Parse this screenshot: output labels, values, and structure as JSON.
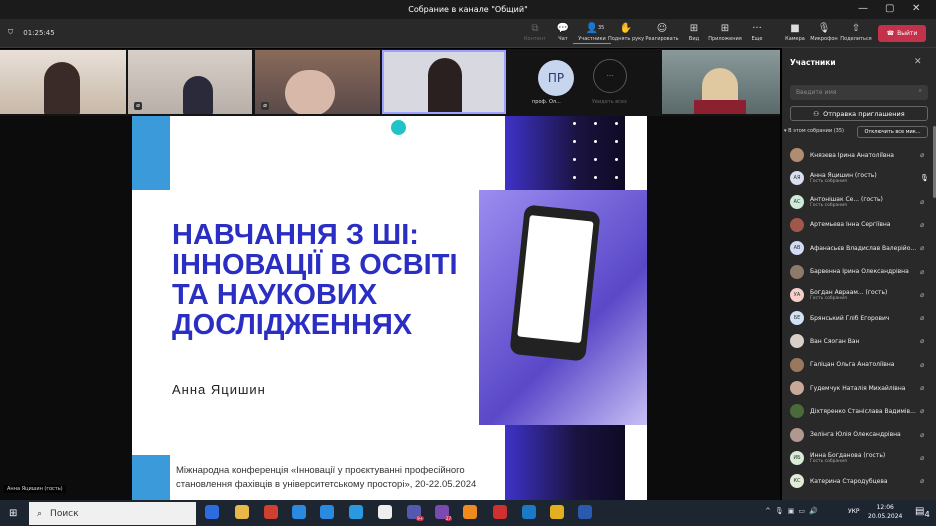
{
  "window": {
    "title": "Собрание в канале \"Общий\"",
    "minimize": "—",
    "maximize": "▢",
    "close": "✕"
  },
  "toolbar": {
    "timer": "01:25:45",
    "items": [
      {
        "label": "Контент",
        "icon": "share-icon",
        "glyph": "⧉"
      },
      {
        "label": "Чат",
        "icon": "chat-icon",
        "glyph": "💬"
      },
      {
        "label": "Участники",
        "icon": "people-icon",
        "glyph": "👤",
        "count": "35"
      },
      {
        "label": "Поднять руку",
        "icon": "hand-icon",
        "glyph": "✋"
      },
      {
        "label": "Реагировать",
        "icon": "emoji-icon",
        "glyph": "☺"
      },
      {
        "label": "Вид",
        "icon": "grid-icon",
        "glyph": "⊞"
      },
      {
        "label": "Приложения",
        "icon": "plus-icon",
        "glyph": "⊞"
      },
      {
        "label": "Еще",
        "icon": "more-icon",
        "glyph": "···"
      },
      {
        "label": "Камера",
        "icon": "camera-icon",
        "glyph": "■"
      },
      {
        "label": "Микрофон",
        "icon": "mic-off-icon",
        "glyph": "🎙"
      },
      {
        "label": "Поделиться",
        "icon": "share-screen-icon",
        "glyph": "⇧"
      }
    ],
    "leave": "Выйти"
  },
  "strip": {
    "avatar_initials": "ПР",
    "avatar_name": "проф. Ол...",
    "more_label": "Увидеть всех",
    "more_glyph": "···"
  },
  "slide": {
    "title": "НАВЧАННЯ З ШІ: ІННОВАЦІЇ В ОСВІТІ ТА НАУКОВИХ ДОСЛІДЖЕННЯХ",
    "author": "Анна Яцишин",
    "footer": "Міжнародна конференція «Інновації у проєктуванні професійного становлення фахівців в університетському просторі», 20-22.05.2024"
  },
  "speaker_label": "Анна Яцишин (гость)",
  "panel": {
    "title": "Участники",
    "search_placeholder": "Введите имя",
    "invite": "Отправка приглашения",
    "section": "В этом собрании (35)",
    "mute_all": "Отключить все мик...",
    "participants": [
      {
        "name": "Князева Ірина Анатоліївна",
        "initials": "",
        "color": "#b08c70"
      },
      {
        "name": "Анна Яцишин (гость)",
        "sub": "Гость собрания",
        "initials": "АЯ",
        "color": "#d9dff0",
        "mic": "on"
      },
      {
        "name": "Антонішак Се...  (гость)",
        "sub": "Гость собрания",
        "initials": "АС",
        "color": "#cdebd8"
      },
      {
        "name": "Артемьева Інна Сергіївна",
        "initials": "",
        "color": "#a0584a"
      },
      {
        "name": "Афанасьєв Владислав Валерійо...",
        "initials": "АВ",
        "color": "#d2dcf5"
      },
      {
        "name": "Барвенна Ірина Олександрівна",
        "initials": "",
        "color": "#8c7a6a"
      },
      {
        "name": "Богдан Авраам... (гость)",
        "sub": "Гость собрания",
        "initials": "УА",
        "color": "#f5d0c8"
      },
      {
        "name": "Брянський Гліб Егорович",
        "initials": "БЕ",
        "color": "#d2e2f5"
      },
      {
        "name": "Ван Сяоган Ван",
        "initials": "",
        "color": "#d8d0c8"
      },
      {
        "name": "Галіцан Ольга Анатоліївна",
        "initials": "",
        "color": "#9a7860"
      },
      {
        "name": "Гудемчук Наталія Михайлівна",
        "initials": "",
        "color": "#c8a898"
      },
      {
        "name": "Діхтяренко Станіслава Вадимів...",
        "initials": "",
        "color": "#4a6a3a"
      },
      {
        "name": "Зелінга Юлія Олександрівна",
        "initials": "",
        "color": "#b09890"
      },
      {
        "name": "Инна Богданова (гость)",
        "sub": "Гость собрания",
        "initials": "ИБ",
        "color": "#d8ecd8"
      },
      {
        "name": "Катерина Стародубцева",
        "initials": "КС",
        "color": "#e0ecd8"
      }
    ]
  },
  "taskbar": {
    "search": "Поиск",
    "lang": "УКР",
    "time": "12:06",
    "date": "20.05.2024",
    "notifications": "4",
    "teams_badge": "9+",
    "viber_badge": "27"
  }
}
